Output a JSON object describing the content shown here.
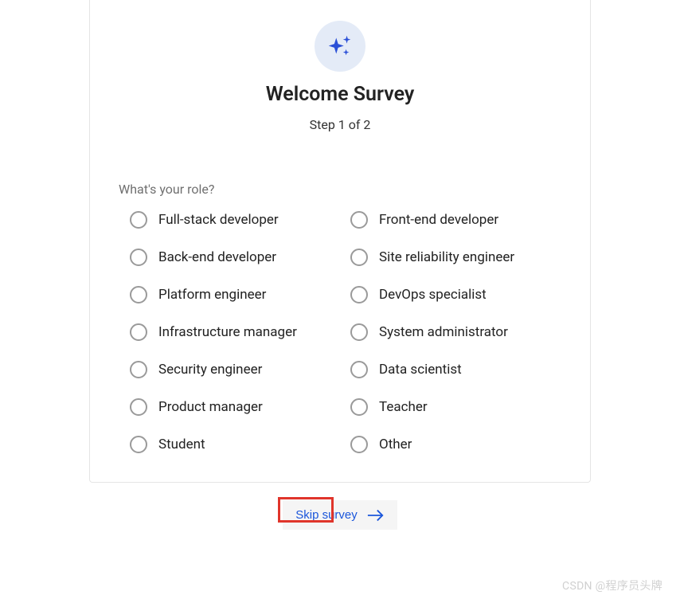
{
  "header": {
    "title": "Welcome Survey",
    "step": "Step 1 of 2"
  },
  "question": "What's your role?",
  "options": [
    "Full-stack developer",
    "Front-end developer",
    "Back-end developer",
    "Site reliability engineer",
    "Platform engineer",
    "DevOps specialist",
    "Infrastructure manager",
    "System administrator",
    "Security engineer",
    "Data scientist",
    "Product manager",
    "Teacher",
    "Student",
    "Other"
  ],
  "actions": {
    "skip_label": "Skip survey"
  },
  "watermark": "CSDN @程序员头牌"
}
